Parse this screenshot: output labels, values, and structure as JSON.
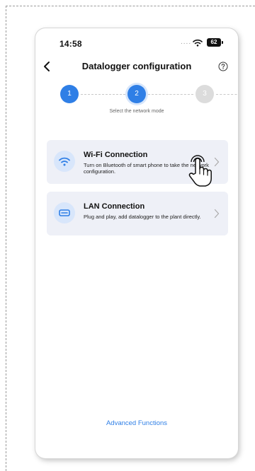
{
  "status_bar": {
    "time": "14:58",
    "signal_dots": "....",
    "battery": "62"
  },
  "nav": {
    "title": "Datalogger configuration"
  },
  "stepper": {
    "steps": [
      {
        "number": "1",
        "state": "done"
      },
      {
        "number": "2",
        "state": "active"
      },
      {
        "number": "3",
        "state": "pending"
      }
    ],
    "caption": "Select the network mode"
  },
  "options": [
    {
      "title": "Wi-Fi Connection",
      "description": "Turn on Bluetooth of smart phone to take the network configuration.",
      "icon": "wifi-icon"
    },
    {
      "title": "LAN Connection",
      "description": "Plug and play, add datalogger to the plant directly.",
      "icon": "ethernet-icon"
    }
  ],
  "footer": {
    "advanced_label": "Advanced Functions"
  },
  "colors": {
    "accent": "#2f7fe6",
    "card_bg": "#eef0f7",
    "step_pending": "#dcdcdc"
  }
}
